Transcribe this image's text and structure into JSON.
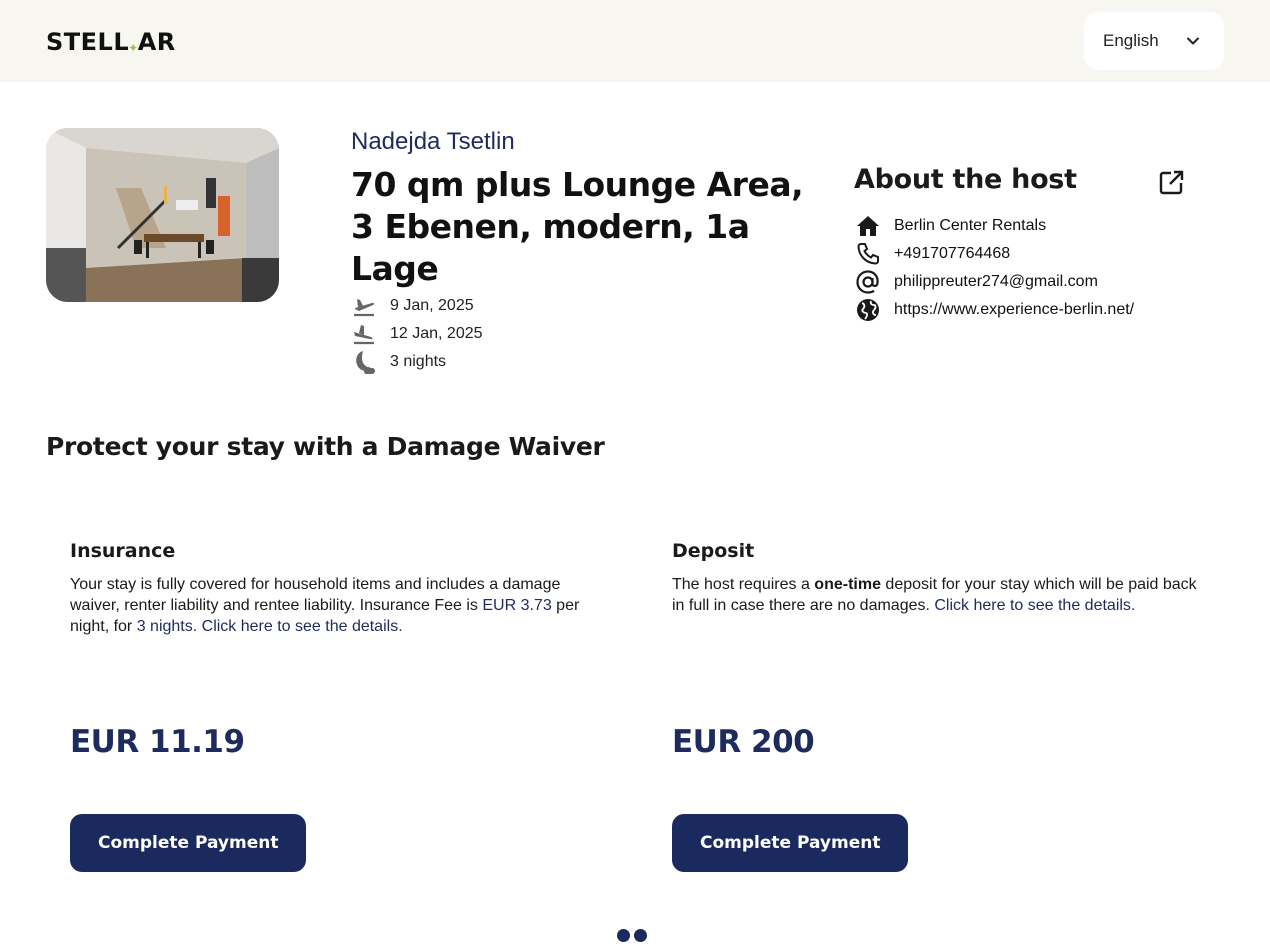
{
  "header": {
    "logo_left": "STELL",
    "logo_right": "AR",
    "language": "English"
  },
  "booking": {
    "guest_name": "Nadejda Tsetlin",
    "title": "70 qm plus Lounge Area, 3 Ebenen, modern, 1a Lage",
    "checkin": "9 Jan, 2025",
    "checkout": "12 Jan, 2025",
    "nights": "3 nights"
  },
  "host": {
    "heading": "About the host",
    "name": "Berlin Center Rentals",
    "phone": "+491707764468",
    "email": "philippreuter274@gmail.com",
    "website": "https://www.experience-berlin.net/"
  },
  "section": {
    "title": "Protect your stay with a Damage Waiver"
  },
  "insurance": {
    "heading": "Insurance",
    "text_1": "Your stay is fully covered for household items and includes a damage waiver, renter liability and rentee liability. Insurance Fee is ",
    "fee": "EUR 3.73",
    "text_2": " per night, for ",
    "nights": "3 nights",
    "text_3": ". ",
    "details_link": "Click here to see the details.",
    "price": "EUR 11.19",
    "button": "Complete Payment"
  },
  "deposit": {
    "heading": "Deposit",
    "text_1": "The host requires a ",
    "bold": "one-time",
    "text_2": " deposit for your stay which will be paid back in full in case there are no damages. ",
    "details_link": "Click here to see the details.",
    "price": "EUR 200",
    "button": "Complete Payment"
  },
  "pagination": {
    "pages": 2
  },
  "colors": {
    "navy": "#1b2a5e",
    "topbar": "#f7f6f1",
    "logo_accent": "#9bc53d"
  },
  "icons": [
    "chevron-down-icon",
    "plane-takeoff-icon",
    "plane-landing-icon",
    "moon-icon",
    "external-link-icon",
    "home-icon",
    "phone-icon",
    "at-sign-icon",
    "globe-icon"
  ]
}
